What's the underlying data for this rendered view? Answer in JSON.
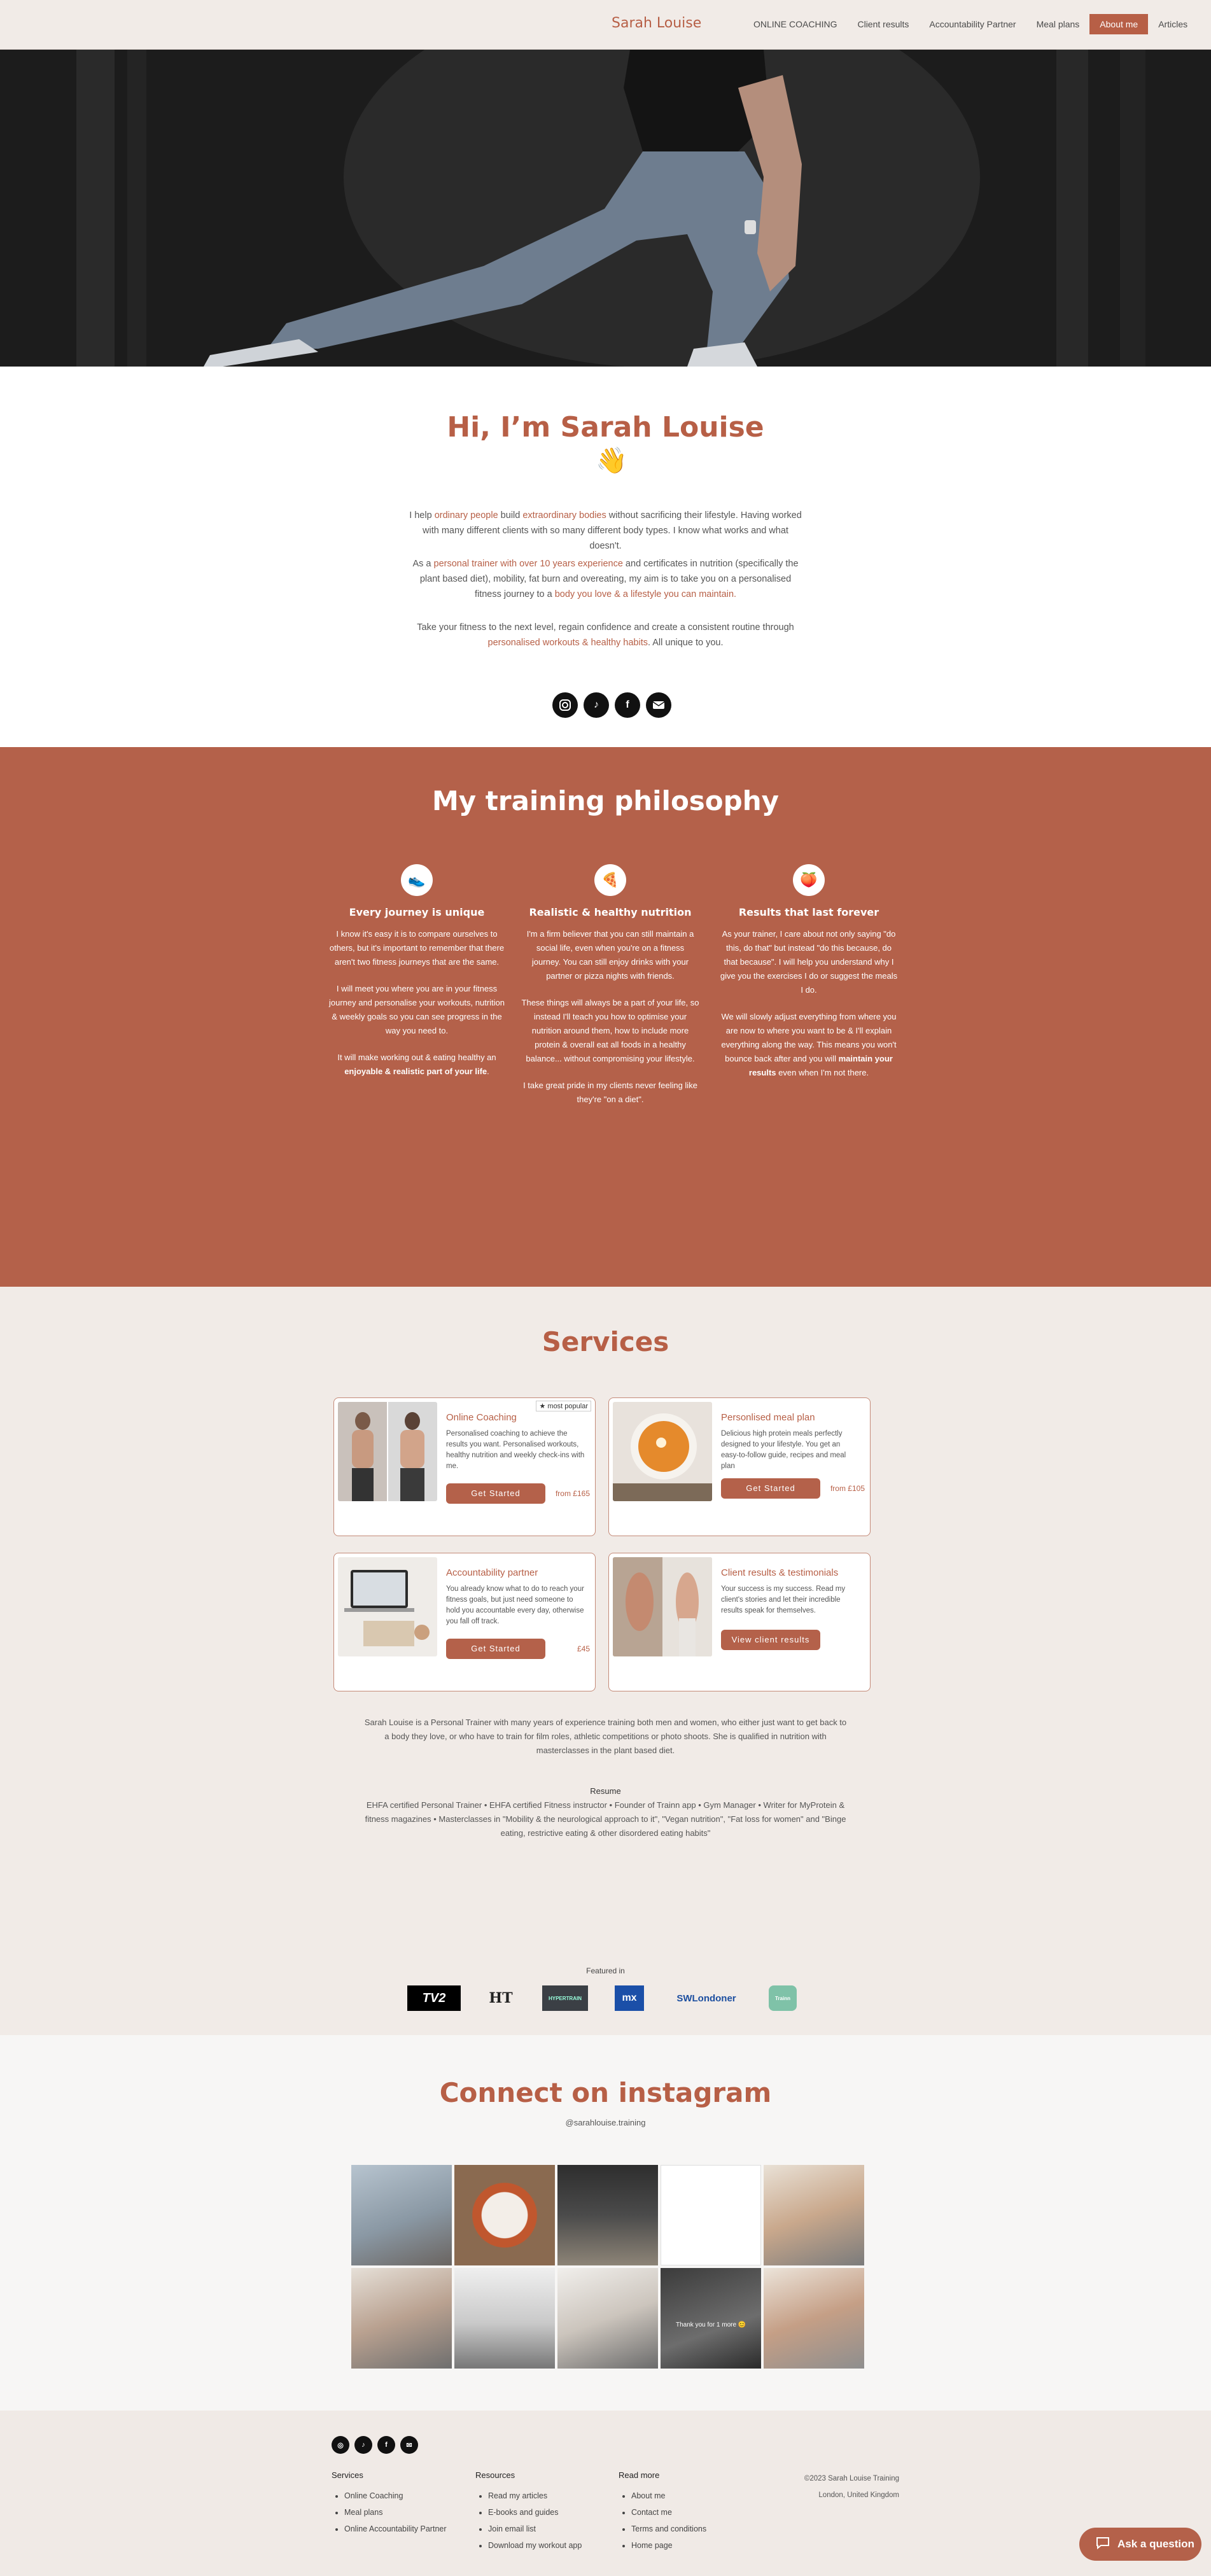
{
  "header": {
    "logo": "Sarah Louise",
    "nav": [
      "ONLINE COACHING",
      "Client results",
      "Accountability Partner",
      "Meal plans",
      "About me",
      "Articles"
    ],
    "active": "About me"
  },
  "intro": {
    "title": "Hi, I’m Sarah Louise",
    "wave": "👋",
    "p1_a": "I help ",
    "p1_b": "ordinary people",
    "p1_c": " build ",
    "p1_d": "extraordinary bodies",
    "p1_e": " without sacrificing their lifestyle. Having worked with many different clients with so many different body types. I know what works and what doesn't.",
    "p2_a": "As a ",
    "p2_b": "personal trainer with over 10 years experience",
    "p2_c": " and certificates in nutrition (specifically the plant based diet), mobility, fat burn and overeating, my aim is to take you on a personalised fitness journey to a ",
    "p2_d": "body you love & a lifestyle you can maintain.",
    "p3_a": "Take your fitness to the next level, regain confidence and create a consistent routine through ",
    "p3_b": "personalised workouts & healthy habits",
    "p3_c": ". All unique to you."
  },
  "philosophy": {
    "title": "My training philosophy",
    "cols": [
      {
        "icon": "shoe-icon",
        "heading": "Every journey is unique",
        "p1": "I know it's easy it is to compare ourselves to others, but it's important to remember that there aren't two fitness journeys that are the same.",
        "p2": "I will meet you where you are in your fitness journey and personalise your workouts, nutrition & weekly goals so you can see progress in the way you need to.",
        "p3a": "It will make working out & eating healthy an ",
        "p3b": "enjoyable & realistic part of your life",
        "p3c": "."
      },
      {
        "icon": "pizza-icon",
        "heading": "Realistic & healthy nutrition",
        "p1": "I'm a firm believer that you can still maintain a social life, even when you're on a fitness journey. You can still enjoy drinks with your partner or pizza nights with friends.",
        "p2": "These things will always be a part of your life, so instead I'll teach you how to optimise your nutrition around them, how to include more protein & overall eat all foods in a healthy balance... without compromising your lifestyle.",
        "p3": "I take great pride in my clients never feeling like they're \"on a diet\"."
      },
      {
        "icon": "peach-icon",
        "heading": "Results that last forever",
        "p1": "As your trainer, I care about not only saying \"do this, do that\" but instead \"do this because, do that because\". I will help you understand why I give you the exercises I do or suggest the meals I do.",
        "p2a": "We will slowly adjust everything from where you are now to where you want to be & I'll explain everything along the way. This means you won't bounce back after and you will ",
        "p2b": "maintain your results",
        "p2c": " even when I'm not there."
      }
    ]
  },
  "services": {
    "title": "Services",
    "cards": [
      {
        "title": "Online Coaching",
        "badge": "★ most popular",
        "desc": "Personalised coaching to achieve the results you want. Personalised workouts, healthy nutrition and weekly check-ins with me.",
        "button": "Get Started",
        "price": "from £165"
      },
      {
        "title": "Personlised meal plan",
        "desc": "Delicious high protein meals perfectly designed to your lifestyle. You get an easy-to-follow guide, recipes and meal plan",
        "button": "Get Started",
        "price": "from £105"
      },
      {
        "title": "Accountability partner",
        "desc": "You already know what to do to reach your fitness goals, but just need someone to hold you accountable every day, otherwise you fall off track.",
        "button": "Get Started",
        "price": "£45"
      },
      {
        "title": "Client results & testimonials",
        "desc": "Your success is my success. Read my client's stories and let their incredible results speak for themselves.",
        "button": "View client results"
      }
    ],
    "bio": "Sarah Louise is a Personal Trainer with many years of experience training both men and women, who either just want to get back to a body they love, or who have to train for film roles, athletic competitions or photo shoots. She is qualified in nutrition with masterclasses in the plant based diet.",
    "resume_title": "Resume",
    "resume": "EHFA certified Personal Trainer • EHFA certified Fitness instructor • Founder of Trainn app • Gym Manager • Writer for MyProtein & fitness magazines • Masterclasses in \"Mobility & the neurological approach to it\", \"Vegan nutrition\", \"Fat loss for women\" and \"Binge eating, restrictive eating & other disordered eating habits\"",
    "featured": "Featured in",
    "logos": [
      "TV2",
      "HT",
      "HYPERTRAIN",
      "mx",
      "SWLondoner",
      "Trainn"
    ]
  },
  "instagram": {
    "title": "Connect on instagram",
    "handle": "@sarahlouise.training",
    "tile_note": "Thank you for 1 more 😊"
  },
  "footer": {
    "socials": [
      "instagram-icon",
      "tiktok-icon",
      "facebook-icon",
      "email-icon"
    ],
    "col1_title": "Services",
    "col1": [
      "Online Coaching",
      "Meal plans",
      "Online Accountability Partner"
    ],
    "col2_title": "Resources",
    "col2": [
      "Read my articles",
      "E-books and guides",
      "Join email list",
      "Download my workout app"
    ],
    "col3_title": "Read more",
    "col3": [
      "About me",
      "Contact me",
      "Terms and conditions",
      "Home page"
    ],
    "copyright": "©2023 Sarah Louise Training",
    "location": "London, United Kingdom"
  },
  "chat": {
    "label": "Ask a question"
  },
  "colors": {
    "accent": "#b75f46",
    "philosophy_bg": "#b4614a",
    "page_bg": "#f1ebe7"
  }
}
